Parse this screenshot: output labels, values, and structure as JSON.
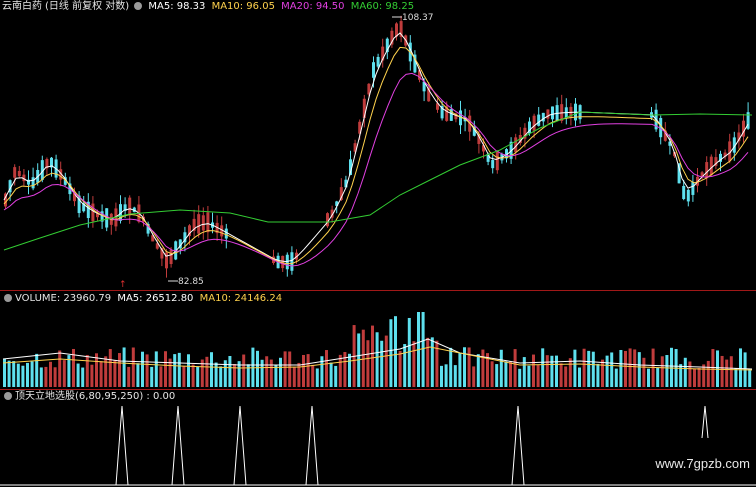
{
  "chart": {
    "stock_name": "云南白药",
    "mode": "(日线 前复权 对数)",
    "ma": [
      {
        "label": "MA5: 98.33",
        "color": "#ffffff"
      },
      {
        "label": "MA10: 96.05",
        "color": "#ffd24d"
      },
      {
        "label": "MA20: 94.50",
        "color": "#e040e0"
      },
      {
        "label": "MA60: 98.25",
        "color": "#33cc33"
      }
    ],
    "high_label": "108.37",
    "low_label": "82.85",
    "arrow_mark": "↑"
  },
  "volume": {
    "label": "VOLUME: 23960.79",
    "ma5": "MA5: 26512.80",
    "ma10": "MA10: 24146.24"
  },
  "indicator": {
    "label": "顶天立地选股(6,80,95,250) : 0.00"
  },
  "watermark": "www.7gpzb.com",
  "colors": {
    "up": "#c03c3c",
    "down": "#5ee0ee",
    "ma5": "#ffffff",
    "ma10": "#ffd24d",
    "ma20": "#e040e0",
    "ma60": "#33cc33",
    "separator": "#a01818"
  }
}
